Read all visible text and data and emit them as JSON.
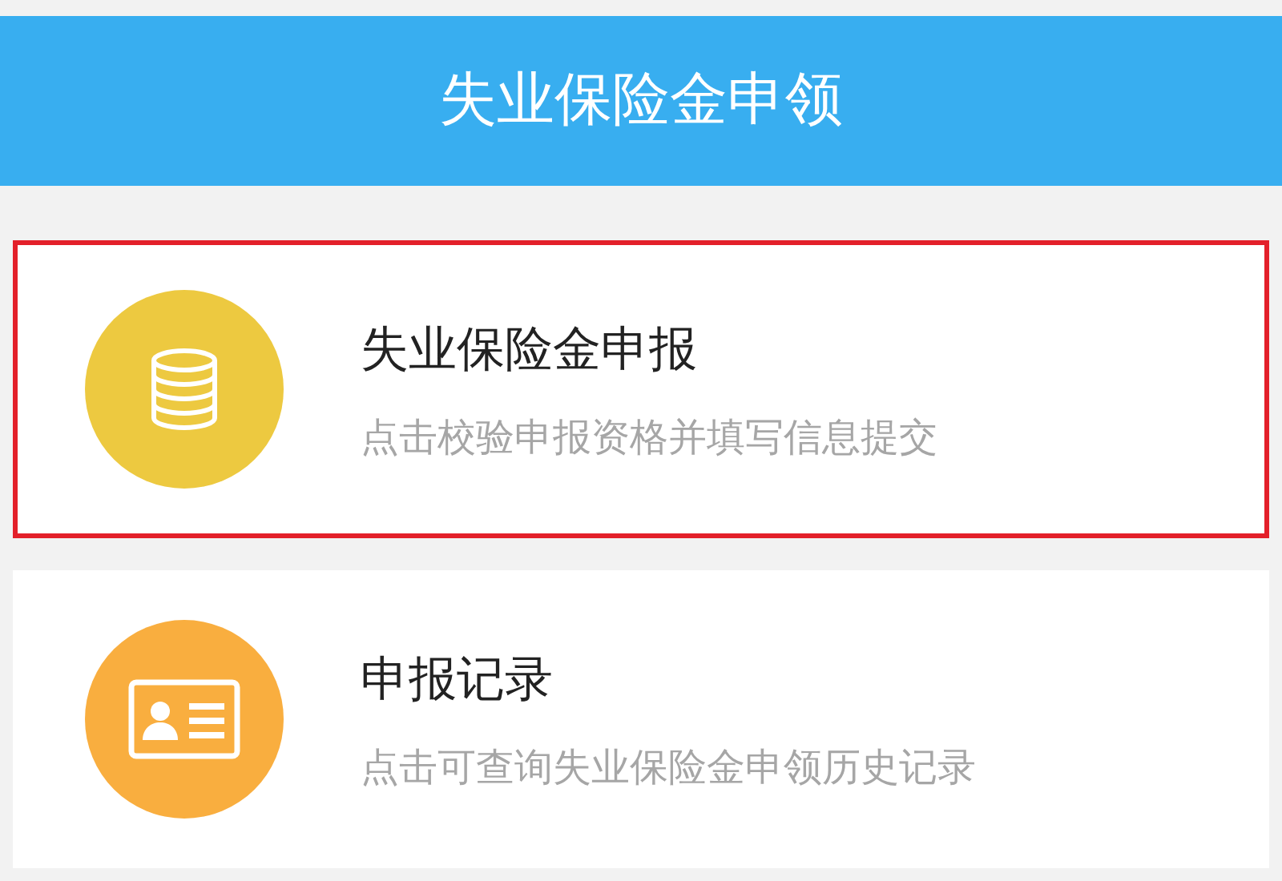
{
  "header": {
    "title": "失业保险金申领"
  },
  "items": [
    {
      "kind": "coins",
      "title": "失业保险金申报",
      "subtitle": "点击校验申报资格并填写信息提交",
      "color": "#edc940",
      "highlighted": true
    },
    {
      "kind": "card",
      "title": "申报记录",
      "subtitle": "点击可查询失业保险金申领历史记录",
      "color": "#f9ae3f",
      "highlighted": false
    }
  ]
}
